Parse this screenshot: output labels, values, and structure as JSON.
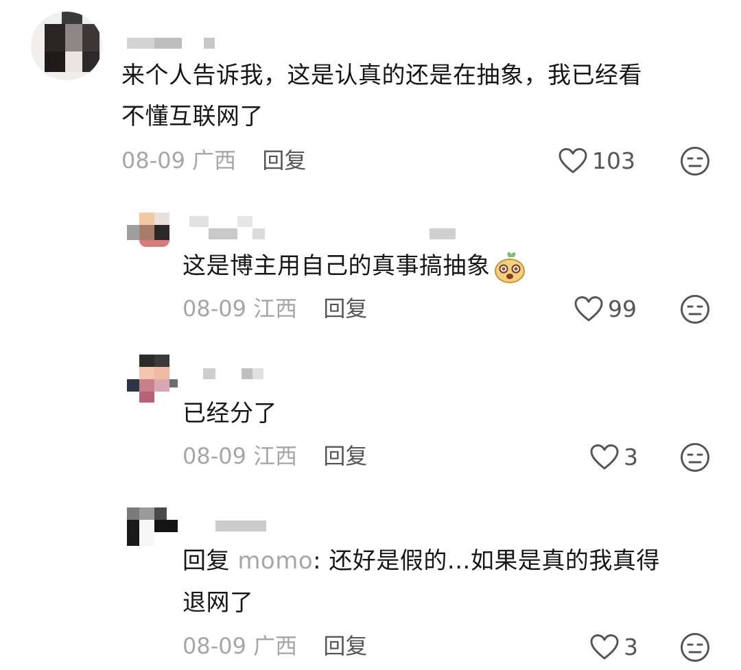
{
  "comments": [
    {
      "text_line1": "来个人告诉我，这是认真的还是在抽象，我已经看",
      "text_line2": "不懂互联网了",
      "date": "08-09",
      "location": "广西",
      "reply_label": "回复",
      "likes": "103"
    },
    {
      "text": "这是博主用自己的真事搞抽象",
      "emoji": "laughing-mascot-emoji",
      "date": "08-09",
      "location": "江西",
      "reply_label": "回复",
      "likes": "99"
    },
    {
      "text": "已经分了",
      "date": "08-09",
      "location": "江西",
      "reply_label": "回复",
      "likes": "3"
    },
    {
      "reply_prefix": "回复",
      "mention": "momo",
      "text_line1_rest": ": 还好是假的...如果是真的我真得",
      "text_line2": "退网了",
      "date": "08-09",
      "location": "广西",
      "reply_label": "回复",
      "likes": "3"
    }
  ],
  "icons": {
    "like": "heart-outline-icon",
    "dislike": "meh-face-icon"
  },
  "colors": {
    "text": "#161616",
    "meta": "#a6a6a6",
    "action": "#555555"
  }
}
